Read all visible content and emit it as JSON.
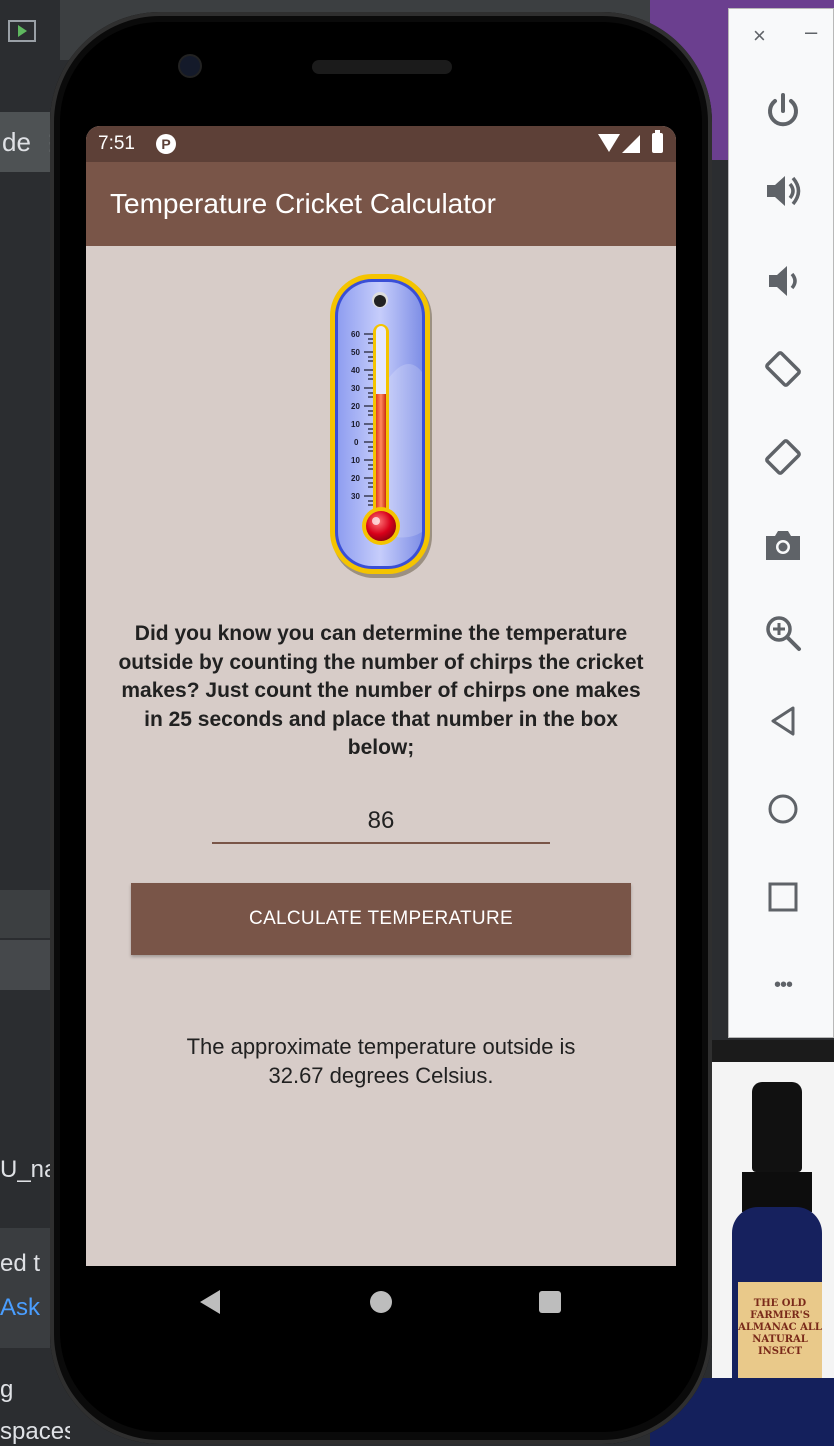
{
  "desktop": {
    "ide_tab_text": "de",
    "ide_dots": "⋮",
    "ide_line1": "U_na",
    "ide_line2": "ed t",
    "ide_line3": "Ask",
    "ide_line4": "g",
    "ide_line5": "spaces",
    "ad_label": "THE OLD FARMER'S ALMANAC ALL NATURAL INSECT"
  },
  "emulator_toolbar": {
    "close_label": "×",
    "minimize_label": "–",
    "more_label": "•••"
  },
  "status_bar": {
    "time": "7:51",
    "notification_icon": "P"
  },
  "app_bar": {
    "title": "Temperature Cricket Calculator"
  },
  "thermometer": {
    "scale_labels": [
      "60",
      "50",
      "40",
      "30",
      "20",
      "10",
      "0",
      "10",
      "20",
      "30"
    ]
  },
  "main": {
    "info_text": "Did you know you can determine the temperature outside by counting the number of chirps the cricket makes? Just count the number of chirps one makes in 25 seconds and place that number in the box below;",
    "chirp_input_value": "86",
    "calculate_button_label": "CALCULATE TEMPERATURE",
    "result_line1": "The approximate temperature outside is",
    "result_line2": "32.67 degrees Celsius."
  },
  "colors": {
    "status_bar": "#5d4037",
    "app_bar": "#795548",
    "screen_background": "#d7ccc8",
    "button": "#795548"
  }
}
